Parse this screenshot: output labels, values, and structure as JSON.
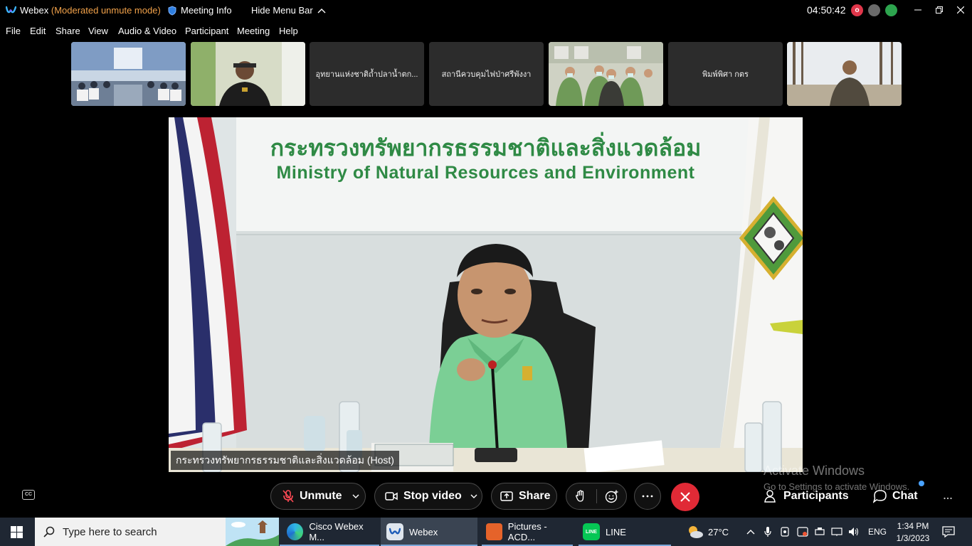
{
  "window": {
    "app_name": "Webex",
    "mode": "(Moderated unmute mode)",
    "meeting_info": "Meeting Info",
    "hide_menu_bar": "Hide Menu Bar",
    "clock": "04:50:42",
    "rec_badge": "o"
  },
  "menu": [
    "File",
    "Edit",
    "Share",
    "View",
    "Audio & Video",
    "Participant",
    "Meeting",
    "Help"
  ],
  "thumbnails": {
    "t3": "อุทยานแห่งชาติถ้ำปลาน้ำตก...",
    "t4": "สถานีควบคุมไฟป่าศรีพังงา",
    "t6": "พิมพ์พิศา กตร"
  },
  "main_video": {
    "banner_thai": "กระทรวงทรัพยากรธรรมชาติและสิ่งแวดล้อม",
    "banner_en": "Ministry of Natural Resources and Environment",
    "host_label": "กระทรวงทรัพยากรธรรมชาติและสิ่งแวดล้อม (Host)"
  },
  "controls": {
    "unmute": "Unmute",
    "stop_video": "Stop video",
    "share": "Share",
    "participants": "Participants",
    "chat": "Chat",
    "cc": "CC"
  },
  "watermark": {
    "line1": "Activate Windows",
    "line2": "Go to Settings to activate Windows."
  },
  "taskbar": {
    "search_placeholder": "Type here to search",
    "apps": [
      "Cisco Webex M...",
      "Webex",
      "Pictures - ACD...",
      "LINE"
    ],
    "weather": "27°C",
    "lang": "ENG",
    "time": "1:34 PM",
    "date": "1/3/2023"
  },
  "colors": {
    "accent_mode": "#f2a24a",
    "leave_red": "#e02a36",
    "banner_green": "#2f8a45",
    "taskbar": "#1f2733"
  }
}
